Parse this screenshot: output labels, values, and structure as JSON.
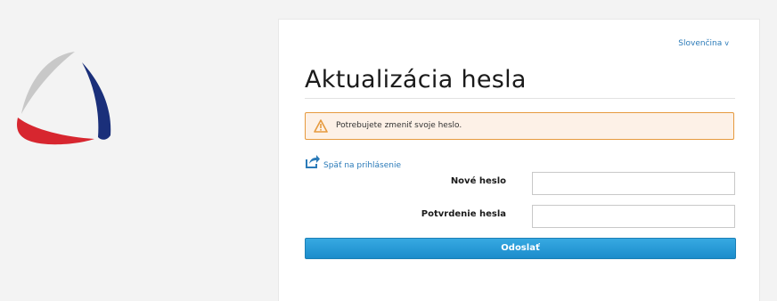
{
  "language_selector": {
    "label": "Slovenčina",
    "chevron": "v"
  },
  "page_title": "Aktualizácia hesla",
  "alert": {
    "icon": "warning-triangle-icon",
    "message": "Potrebujete zmeniť svoje heslo.",
    "border_color": "#e69a3e",
    "background_color": "#fdf1e7"
  },
  "back_link": {
    "icon": "share-arrow-icon",
    "label": "Späť na prihlásenie"
  },
  "form": {
    "new_password_label": "Nové heslo",
    "new_password_value": "",
    "confirm_password_label": "Potvrdenie hesla",
    "confirm_password_value": "",
    "submit_label": "Odoslať"
  },
  "colors": {
    "accent": "#2a7ab8",
    "button": "#1b8ccb",
    "logo_red": "#d7262f",
    "logo_navy": "#1a2f7a",
    "logo_gray": "#c8c8c8"
  }
}
